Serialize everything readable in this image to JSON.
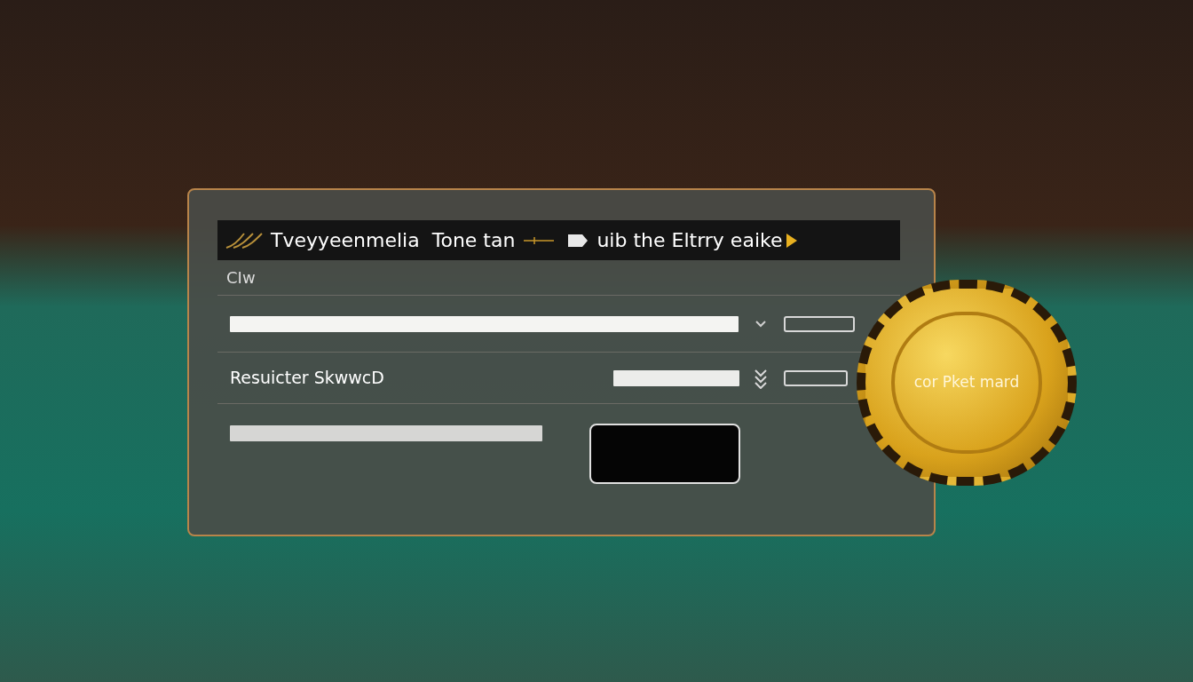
{
  "header": {
    "title": "Tveyyeenmelia",
    "subtitle": "Tone tan",
    "action": "uib the Eltrry eaike"
  },
  "section_label": "CIw",
  "rows": [
    {
      "kind": "select"
    },
    {
      "kind": "labeled",
      "label": "Resuicter SkwwcD"
    },
    {
      "kind": "submit"
    }
  ],
  "chip": {
    "label": "cor Pket mard"
  }
}
